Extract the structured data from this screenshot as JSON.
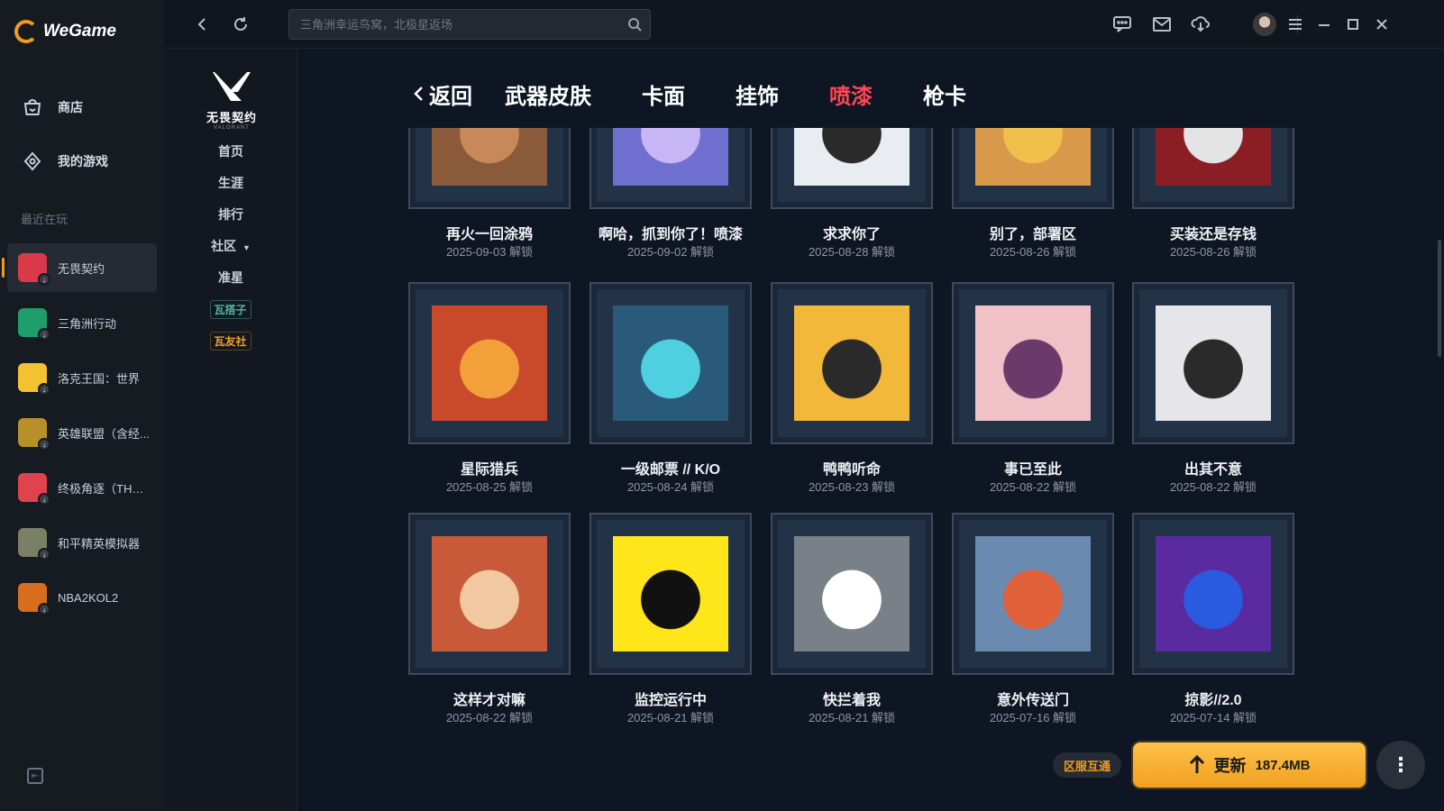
{
  "app": {
    "brand": "WeGame"
  },
  "sidebar": {
    "nav": [
      {
        "label": "商店",
        "icon": "store-bag-icon"
      },
      {
        "label": "我的游戏",
        "icon": "gamepad-icon"
      }
    ],
    "recent_title": "最近在玩",
    "games": [
      {
        "name": "无畏契约",
        "color": "#d83a4a",
        "active": true
      },
      {
        "name": "三角洲行动",
        "color": "#1e9e6a",
        "active": false
      },
      {
        "name": "洛克王国：世界",
        "color": "#f2c230",
        "active": false
      },
      {
        "name": "英雄联盟（含经...",
        "color": "#b8902a",
        "active": false
      },
      {
        "name": "终极角逐（THE ...",
        "color": "#e0434d",
        "active": false
      },
      {
        "name": "和平精英模拟器",
        "color": "#7a7f66",
        "active": false
      },
      {
        "name": "NBA2KOL2",
        "color": "#d86d1e",
        "active": false
      }
    ]
  },
  "topbar": {
    "search_placeholder": "三角洲幸运鸟窝，北极星返场"
  },
  "subnav": {
    "logo_text": "无畏契约",
    "logo_sub": "VALORANT",
    "items": [
      "首页",
      "生涯",
      "排行",
      "社区",
      "准星"
    ],
    "tags": [
      {
        "label": "瓦搭子",
        "color": "#4fb6a0"
      },
      {
        "label": "瓦友社",
        "color": "#f0a12a"
      }
    ]
  },
  "tabs": {
    "back_label": "返回",
    "items": [
      {
        "label": "武器皮肤",
        "active": false
      },
      {
        "label": "卡面",
        "active": false
      },
      {
        "label": "挂饰",
        "active": false
      },
      {
        "label": "喷漆",
        "active": true
      },
      {
        "label": "枪卡",
        "active": false
      }
    ]
  },
  "sprays": [
    {
      "name": "再火一回涂鸦",
      "date": "2025-09-03 解锁",
      "bg": "#8a5a3a",
      "fg": "#c8895a"
    },
    {
      "name": "啊哈，抓到你了！喷漆",
      "date": "2025-09-02 解锁",
      "bg": "#6f6fd0",
      "fg": "#c7b6f5"
    },
    {
      "name": "求求你了",
      "date": "2025-08-28 解锁",
      "bg": "#e9edf2",
      "fg": "#2a2a2a"
    },
    {
      "name": "别了，部署区",
      "date": "2025-08-26 解锁",
      "bg": "#d89a4a",
      "fg": "#f0c04a"
    },
    {
      "name": "买装还是存钱",
      "date": "2025-08-26 解锁",
      "bg": "#8b1d25",
      "fg": "#e4e4e4"
    },
    {
      "name": "星际猎兵",
      "date": "2025-08-25 解锁",
      "bg": "#c84a2a",
      "fg": "#f2a13a"
    },
    {
      "name": "一级邮票 // K/O",
      "date": "2025-08-24 解锁",
      "bg": "#2a5a7a",
      "fg": "#4fd0e0"
    },
    {
      "name": "鸭鸭听命",
      "date": "2025-08-23 解锁",
      "bg": "#f2b83a",
      "fg": "#2a2a2a"
    },
    {
      "name": "事已至此",
      "date": "2025-08-22 解锁",
      "bg": "#f0c2c8",
      "fg": "#6a3a6a"
    },
    {
      "name": "出其不意",
      "date": "2025-08-22 解锁",
      "bg": "#e6e6ea",
      "fg": "#2a2a2a"
    },
    {
      "name": "这样才对嘛",
      "date": "2025-08-22 解锁",
      "bg": "#c85a3a",
      "fg": "#f2c8a0"
    },
    {
      "name": "监控运行中",
      "date": "2025-08-21 解锁",
      "bg": "#ffe61a",
      "fg": "#111111"
    },
    {
      "name": "快拦着我",
      "date": "2025-08-21 解锁",
      "bg": "#7a8088",
      "fg": "#ffffff"
    },
    {
      "name": "意外传送门",
      "date": "2025-07-16 解锁",
      "bg": "#6a8ab0",
      "fg": "#e0603a"
    },
    {
      "name": "掠影//2.0",
      "date": "2025-07-14 解锁",
      "bg": "#5a2aa0",
      "fg": "#2a5ae0"
    }
  ],
  "bottom": {
    "region_label": "区服互通",
    "update_label": "更新",
    "update_size": "187.4MB",
    "more_label": "⋮"
  },
  "colors": {
    "accent": "#f39a1e",
    "active_tab": "#ff4655"
  }
}
